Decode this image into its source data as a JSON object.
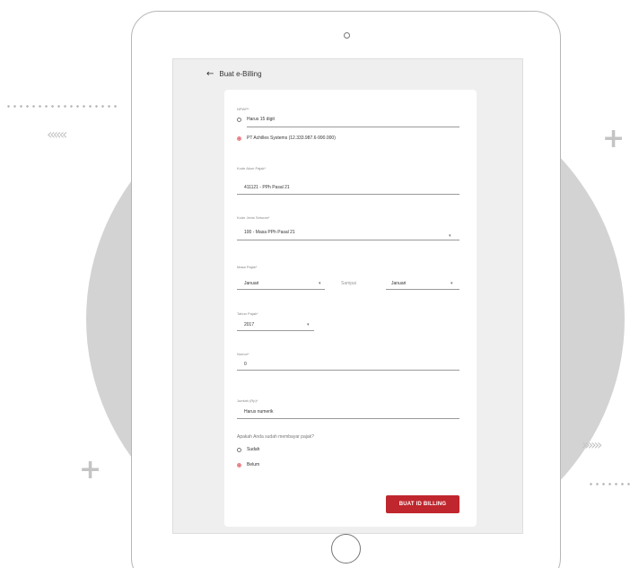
{
  "decor": {
    "chevrons_left": "«««",
    "chevrons_right": "»»»",
    "plus": "+",
    "colors": {
      "circle": "#d3d3d4",
      "decor": "#c4c4c4"
    }
  },
  "header": {
    "back_icon": "arrow-left-icon",
    "title": "Buat e-Billing"
  },
  "form": {
    "npwp": {
      "label": "NPWP*",
      "option_other_placeholder": "Harus 15 digit",
      "option_selected": "PT Achilles Systems (12.333.987.6-990.000)"
    },
    "kode_akun": {
      "label": "Kode Akun Pajak*",
      "value": "411121 - PPh Pasal 21"
    },
    "kode_jenis": {
      "label": "Kode Jenis Setoran*",
      "value": "100 - Masa PPh Pasal 21"
    },
    "masa_pajak": {
      "label": "Masa Pajak*",
      "from": "Januari",
      "separator": "Sampai",
      "to": "Januari"
    },
    "tahun_pajak": {
      "label": "Tahun Pajak*",
      "value": "2017"
    },
    "nomor": {
      "label": "Nomor*",
      "value": "0"
    },
    "jumlah": {
      "label": "Jumlah (Rp)*",
      "placeholder": "Harus numerik"
    },
    "paid_question": "Apakah Anda sudah membayar pajak?",
    "paid_options": [
      "Sudah",
      "Belum"
    ],
    "paid_selected": "Belum",
    "submit_label": "BUAT ID BILLING",
    "accent_color": "#c0262d"
  }
}
